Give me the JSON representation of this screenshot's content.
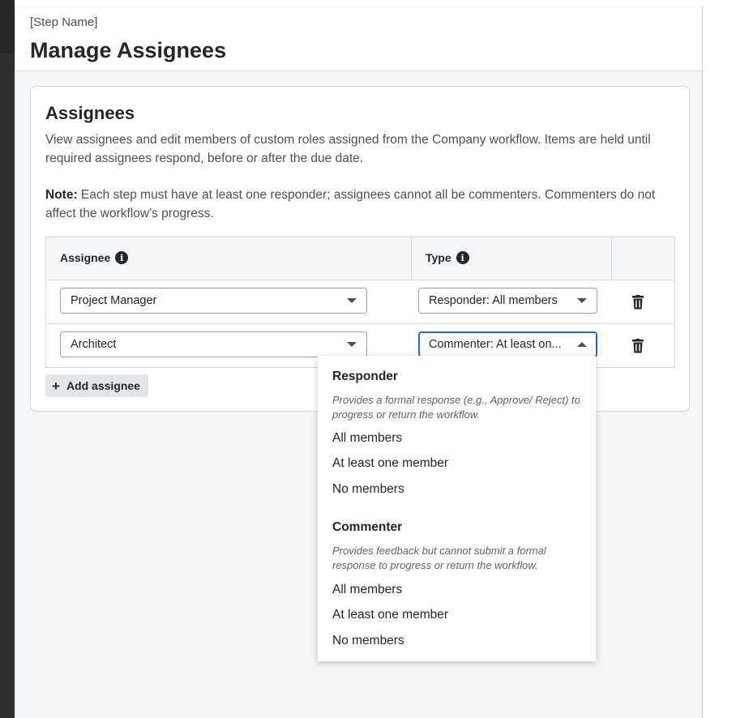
{
  "header": {
    "step_name": "[Step Name]",
    "title": "Manage Assignees"
  },
  "card": {
    "title": "Assignees",
    "description": "View assignees and edit members of custom roles assigned from the Company workflow. Items are held until required assignees respond, before or after the due date.",
    "note_label": "Note:",
    "note_text": " Each step must have at least one responder; assignees cannot all be commenters. Commenters do not affect the workflow's progress."
  },
  "table": {
    "columns": {
      "assignee": "Assignee",
      "type": "Type"
    },
    "rows": [
      {
        "assignee": "Project Manager",
        "type": "Responder: All members"
      },
      {
        "assignee": "Architect",
        "type": "Commenter: At least on..."
      }
    ],
    "add_label": "Add assignee"
  },
  "type_dropdown": {
    "groups": [
      {
        "title": "Responder",
        "description": "Provides a formal response (e.g., Approve/ Reject) to progress or return the workflow.",
        "options": [
          "All members",
          "At least one member",
          "No members"
        ]
      },
      {
        "title": "Commenter",
        "description": "Provides feedback but cannot submit a formal response to progress or return the workflow.",
        "options": [
          "All members",
          "At least one member",
          "No members"
        ]
      }
    ]
  },
  "colors": {
    "focus_border": "#2066df",
    "text_primary": "#232729",
    "border": "#d6dadc"
  },
  "icons": [
    "info-icon",
    "chevron-down-icon",
    "chevron-up-icon",
    "trash-icon",
    "plus-icon"
  ]
}
